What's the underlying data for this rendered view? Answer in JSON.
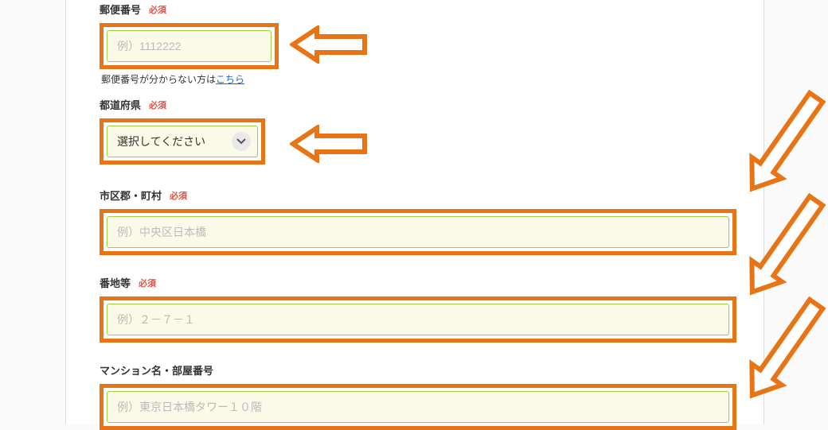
{
  "form": {
    "required_label": "必須",
    "postal": {
      "label": "郵便番号",
      "placeholder": "例）1112222",
      "help_prefix": "郵便番号が分からない方は",
      "help_link": "こちら"
    },
    "prefecture": {
      "label": "都道府県",
      "select_placeholder": "選択してください"
    },
    "city": {
      "label": "市区郡・町村",
      "placeholder": "例）中央区日本橋"
    },
    "street": {
      "label": "番地等",
      "placeholder": "例）２－７－１"
    },
    "building": {
      "label": "マンション名・部屋番号",
      "placeholder": "例）東京日本橋タワー１０階"
    }
  }
}
